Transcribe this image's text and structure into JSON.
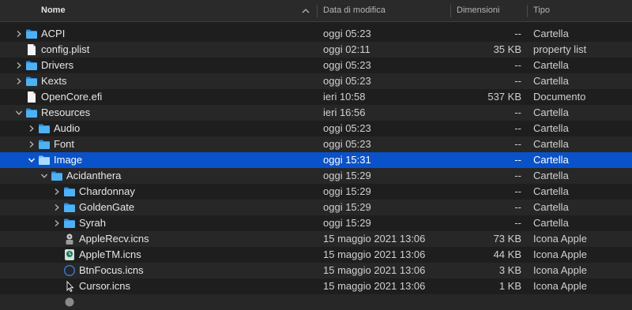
{
  "header": {
    "name_label": "Nome",
    "date_label": "Data di modifica",
    "size_label": "Dimensioni",
    "kind_label": "Tipo"
  },
  "rows": [
    {
      "name": "ACPI",
      "date": "oggi 05:23",
      "size": "--",
      "kind": "Cartella",
      "level": 0,
      "expander": "collapsed",
      "icon": "folder-icon"
    },
    {
      "name": "config.plist",
      "date": "oggi 02:11",
      "size": "35 KB",
      "kind": "property list",
      "level": 0,
      "expander": "none",
      "icon": "document-icon"
    },
    {
      "name": "Drivers",
      "date": "oggi 05:23",
      "size": "--",
      "kind": "Cartella",
      "level": 0,
      "expander": "collapsed",
      "icon": "folder-icon"
    },
    {
      "name": "Kexts",
      "date": "oggi 05:23",
      "size": "--",
      "kind": "Cartella",
      "level": 0,
      "expander": "collapsed",
      "icon": "folder-icon"
    },
    {
      "name": "OpenCore.efi",
      "date": "ieri 10:58",
      "size": "537 KB",
      "kind": "Documento",
      "level": 0,
      "expander": "none",
      "icon": "document-icon"
    },
    {
      "name": "Resources",
      "date": "ieri 16:56",
      "size": "--",
      "kind": "Cartella",
      "level": 0,
      "expander": "expanded",
      "icon": "folder-icon"
    },
    {
      "name": "Audio",
      "date": "oggi 05:23",
      "size": "--",
      "kind": "Cartella",
      "level": 1,
      "expander": "collapsed",
      "icon": "folder-icon"
    },
    {
      "name": "Font",
      "date": "oggi 05:23",
      "size": "--",
      "kind": "Cartella",
      "level": 1,
      "expander": "collapsed",
      "icon": "folder-icon"
    },
    {
      "name": "Image",
      "date": "oggi 15:31",
      "size": "--",
      "kind": "Cartella",
      "level": 1,
      "expander": "expanded",
      "icon": "folder-icon",
      "selected": true
    },
    {
      "name": "Acidanthera",
      "date": "oggi 15:29",
      "size": "--",
      "kind": "Cartella",
      "level": 2,
      "expander": "expanded",
      "icon": "folder-icon"
    },
    {
      "name": "Chardonnay",
      "date": "oggi 15:29",
      "size": "--",
      "kind": "Cartella",
      "level": 3,
      "expander": "collapsed",
      "icon": "folder-icon"
    },
    {
      "name": "GoldenGate",
      "date": "oggi 15:29",
      "size": "--",
      "kind": "Cartella",
      "level": 3,
      "expander": "collapsed",
      "icon": "folder-icon"
    },
    {
      "name": "Syrah",
      "date": "oggi 15:29",
      "size": "--",
      "kind": "Cartella",
      "level": 3,
      "expander": "collapsed",
      "icon": "folder-icon"
    },
    {
      "name": "AppleRecv.icns",
      "date": "15 maggio 2021 13:06",
      "size": "73 KB",
      "kind": "Icona Apple",
      "level": 3,
      "expander": "none",
      "icon": "apple-recovery-icon"
    },
    {
      "name": "AppleTM.icns",
      "date": "15 maggio 2021 13:06",
      "size": "44 KB",
      "kind": "Icona Apple",
      "level": 3,
      "expander": "none",
      "icon": "time-machine-icon"
    },
    {
      "name": "BtnFocus.icns",
      "date": "15 maggio 2021 13:06",
      "size": "3 KB",
      "kind": "Icona Apple",
      "level": 3,
      "expander": "none",
      "icon": "focus-ring-icon"
    },
    {
      "name": "Cursor.icns",
      "date": "15 maggio 2021 13:06",
      "size": "1 KB",
      "kind": "Icona Apple",
      "level": 3,
      "expander": "none",
      "icon": "cursor-icon"
    },
    {
      "name": "",
      "date": "",
      "size": "",
      "kind": "",
      "level": 3,
      "expander": "none",
      "icon": "generic-icns-icon"
    }
  ]
}
